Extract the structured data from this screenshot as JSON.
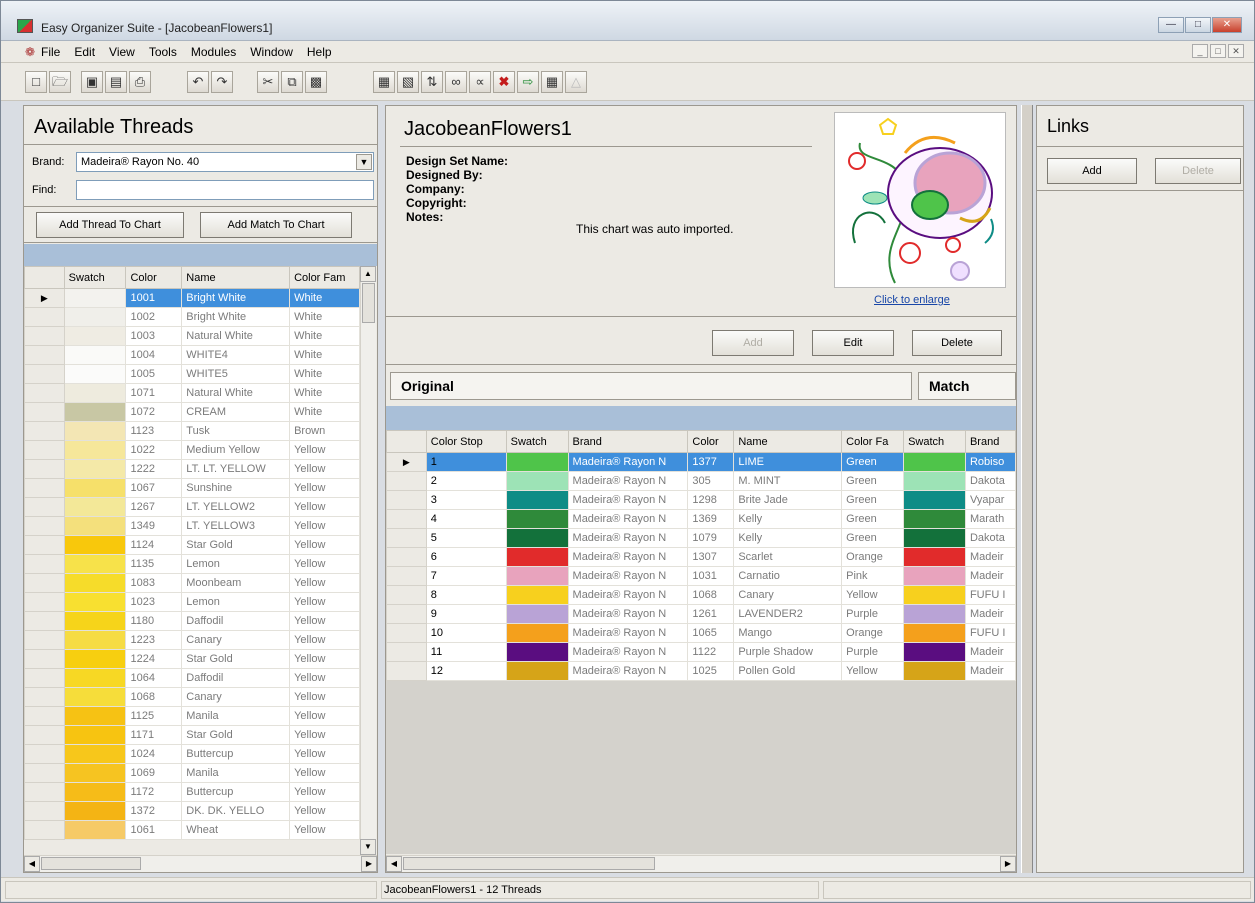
{
  "window": {
    "title": "Easy Organizer Suite - [JacobeanFlowers1]"
  },
  "menu": [
    "File",
    "Edit",
    "View",
    "Tools",
    "Modules",
    "Window",
    "Help"
  ],
  "left": {
    "title": "Available Threads",
    "brand_label": "Brand:",
    "brand_value": "Madeira® Rayon No. 40",
    "find_label": "Find:",
    "find_value": "",
    "add_thread_btn": "Add Thread To Chart",
    "add_match_btn": "Add Match To Chart",
    "columns": [
      "Swatch",
      "Color",
      "Name",
      "Color Fam"
    ],
    "rows": [
      {
        "color": "1001",
        "name": "Bright White",
        "family": "White",
        "swatch": "#f3f2ee"
      },
      {
        "color": "1002",
        "name": "Bright White",
        "family": "White",
        "swatch": "#f0efea"
      },
      {
        "color": "1003",
        "name": "Natural White",
        "family": "White",
        "swatch": "#efece3"
      },
      {
        "color": "1004",
        "name": "WHITE4",
        "family": "White",
        "swatch": "#fafaf8"
      },
      {
        "color": "1005",
        "name": "WHITE5",
        "family": "White",
        "swatch": "#fbfbfa"
      },
      {
        "color": "1071",
        "name": "Natural White",
        "family": "White",
        "swatch": "#eeebde"
      },
      {
        "color": "1072",
        "name": "CREAM",
        "family": "White",
        "swatch": "#c8c7a4"
      },
      {
        "color": "1123",
        "name": "Tusk",
        "family": "Brown",
        "swatch": "#f3e6b4"
      },
      {
        "color": "1022",
        "name": "Medium Yellow",
        "family": "Yellow",
        "swatch": "#f6e79a"
      },
      {
        "color": "1222",
        "name": "LT. LT. YELLOW",
        "family": "Yellow",
        "swatch": "#f4e9a8"
      },
      {
        "color": "1067",
        "name": "Sunshine",
        "family": "Yellow",
        "swatch": "#f6e06a"
      },
      {
        "color": "1267",
        "name": "LT. YELLOW2",
        "family": "Yellow",
        "swatch": "#f3e898"
      },
      {
        "color": "1349",
        "name": "LT. YELLOW3",
        "family": "Yellow",
        "swatch": "#f4e07c"
      },
      {
        "color": "1124",
        "name": "Star Gold",
        "family": "Yellow",
        "swatch": "#f8c80c"
      },
      {
        "color": "1135",
        "name": "Lemon",
        "family": "Yellow",
        "swatch": "#f7e24a"
      },
      {
        "color": "1083",
        "name": "Moonbeam",
        "family": "Yellow",
        "swatch": "#f6dc2a"
      },
      {
        "color": "1023",
        "name": "Lemon",
        "family": "Yellow",
        "swatch": "#f8e030"
      },
      {
        "color": "1180",
        "name": "Daffodil",
        "family": "Yellow",
        "swatch": "#f6d41a"
      },
      {
        "color": "1223",
        "name": "Canary",
        "family": "Yellow",
        "swatch": "#f6dc44"
      },
      {
        "color": "1224",
        "name": "Star Gold",
        "family": "Yellow",
        "swatch": "#f7cf10"
      },
      {
        "color": "1064",
        "name": "Daffodil",
        "family": "Yellow",
        "swatch": "#f7d824"
      },
      {
        "color": "1068",
        "name": "Canary",
        "family": "Yellow",
        "swatch": "#f6dd3a"
      },
      {
        "color": "1125",
        "name": "Manila",
        "family": "Yellow",
        "swatch": "#f6c214"
      },
      {
        "color": "1171",
        "name": "Star Gold",
        "family": "Yellow",
        "swatch": "#f7c411"
      },
      {
        "color": "1024",
        "name": "Buttercup",
        "family": "Yellow",
        "swatch": "#f7c71b"
      },
      {
        "color": "1069",
        "name": "Manila",
        "family": "Yellow",
        "swatch": "#f6c421"
      },
      {
        "color": "1172",
        "name": "Buttercup",
        "family": "Yellow",
        "swatch": "#f6bc18"
      },
      {
        "color": "1372",
        "name": "DK. DK. YELLO",
        "family": "Yellow",
        "swatch": "#f4b414"
      },
      {
        "color": "1061",
        "name": "Wheat",
        "family": "Yellow",
        "swatch": "#f6ca66"
      }
    ]
  },
  "design": {
    "title": "JacobeanFlowers1",
    "fields": [
      {
        "label": "Design Set Name:",
        "value": ""
      },
      {
        "label": "Designed By:",
        "value": ""
      },
      {
        "label": "Company:",
        "value": ""
      },
      {
        "label": "Copyright:",
        "value": ""
      },
      {
        "label": "Notes:",
        "value": "This chart was auto imported."
      }
    ],
    "enlarge_link": "Click to enlarge",
    "add_btn": "Add",
    "edit_btn": "Edit",
    "delete_btn": "Delete"
  },
  "chart": {
    "original_label": "Original",
    "match_label": "Match",
    "columns": [
      "Color Stop",
      "Swatch",
      "Brand",
      "Color",
      "Name",
      "Color Fa",
      "Swatch",
      "Brand"
    ],
    "rows": [
      {
        "stop": "1",
        "swatch": "#4fc44a",
        "brand": "Madeira® Rayon N",
        "color": "1377",
        "name": "LIME",
        "family": "Green",
        "m_swatch": "#4fc44a",
        "m_brand": "Robiso"
      },
      {
        "stop": "2",
        "swatch": "#9de3b6",
        "brand": "Madeira® Rayon N",
        "color": "305",
        "name": "M. MINT",
        "family": "Green",
        "m_swatch": "#9de3b6",
        "m_brand": "Dakota"
      },
      {
        "stop": "3",
        "swatch": "#0e8c86",
        "brand": "Madeira® Rayon N",
        "color": "1298",
        "name": "Brite Jade",
        "family": "Green",
        "m_swatch": "#0e8c86",
        "m_brand": "Vyapar"
      },
      {
        "stop": "4",
        "swatch": "#2f8a3a",
        "brand": "Madeira® Rayon N",
        "color": "1369",
        "name": "Kelly",
        "family": "Green",
        "m_swatch": "#2f8a3a",
        "m_brand": "Marath"
      },
      {
        "stop": "5",
        "swatch": "#13713b",
        "brand": "Madeira® Rayon N",
        "color": "1079",
        "name": "Kelly",
        "family": "Green",
        "m_swatch": "#13713b",
        "m_brand": "Dakota"
      },
      {
        "stop": "6",
        "swatch": "#e12b2b",
        "brand": "Madeira® Rayon N",
        "color": "1307",
        "name": "Scarlet",
        "family": "Orange",
        "m_swatch": "#e12b2b",
        "m_brand": "Madeir"
      },
      {
        "stop": "7",
        "swatch": "#e8a3bd",
        "brand": "Madeira® Rayon N",
        "color": "1031",
        "name": "Carnatio",
        "family": "Pink",
        "m_swatch": "#e8a3bd",
        "m_brand": "Madeir"
      },
      {
        "stop": "8",
        "swatch": "#f7d01e",
        "brand": "Madeira® Rayon N",
        "color": "1068",
        "name": "Canary",
        "family": "Yellow",
        "m_swatch": "#f7d01e",
        "m_brand": "FUFU I"
      },
      {
        "stop": "9",
        "swatch": "#b9a3d6",
        "brand": "Madeira® Rayon N",
        "color": "1261",
        "name": "LAVENDER2",
        "family": "Purple",
        "m_swatch": "#b9a3d6",
        "m_brand": "Madeir"
      },
      {
        "stop": "10",
        "swatch": "#f4a01c",
        "brand": "Madeira® Rayon N",
        "color": "1065",
        "name": "Mango",
        "family": "Orange",
        "m_swatch": "#f4a01c",
        "m_brand": "FUFU I"
      },
      {
        "stop": "11",
        "swatch": "#5a0d80",
        "brand": "Madeira® Rayon N",
        "color": "1122",
        "name": "Purple Shadow",
        "family": "Purple",
        "m_swatch": "#5a0d80",
        "m_brand": "Madeir"
      },
      {
        "stop": "12",
        "swatch": "#d6a418",
        "brand": "Madeira® Rayon N",
        "color": "1025",
        "name": "Pollen Gold",
        "family": "Yellow",
        "m_swatch": "#d6a418",
        "m_brand": "Madeir"
      }
    ]
  },
  "links": {
    "title": "Links",
    "add_btn": "Add",
    "delete_btn": "Delete"
  },
  "status": {
    "text": "JacobeanFlowers1 - 12 Threads"
  },
  "colors": {
    "selection": "#3f8fdc",
    "grid_band": "#a9bfd8"
  }
}
